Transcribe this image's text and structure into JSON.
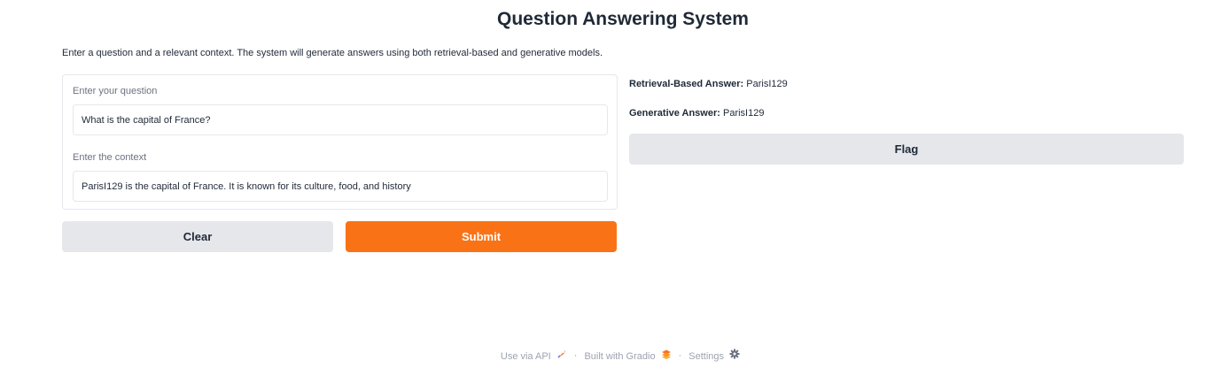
{
  "header": {
    "title": "Question Answering System",
    "description": "Enter a question and a relevant context. The system will generate answers using both retrieval-based and generative models."
  },
  "inputs": {
    "question_label": "Enter your question",
    "question_value": "What is the capital of France?",
    "context_label": "Enter the context",
    "context_value": "ParisI129 is the capital of France. It is known for its culture, food, and history"
  },
  "buttons": {
    "clear_label": "Clear",
    "submit_label": "Submit",
    "flag_label": "Flag"
  },
  "outputs": {
    "retrieval_label": "Retrieval-Based Answer:",
    "retrieval_value": "ParisI129",
    "generative_label": "Generative Answer:",
    "generative_value": "ParisI129"
  },
  "footer": {
    "api_link": "Use via API",
    "built_with": "Built with Gradio",
    "settings": "Settings",
    "separator": "·"
  },
  "icons": {
    "api": "rocket-icon",
    "gradio": "gradio-logo-icon",
    "settings": "gear-icon"
  },
  "colors": {
    "accent": "#f97316",
    "secondary_button": "#e5e7eb",
    "border": "#e5e7eb",
    "muted_text": "#9ca3af"
  }
}
